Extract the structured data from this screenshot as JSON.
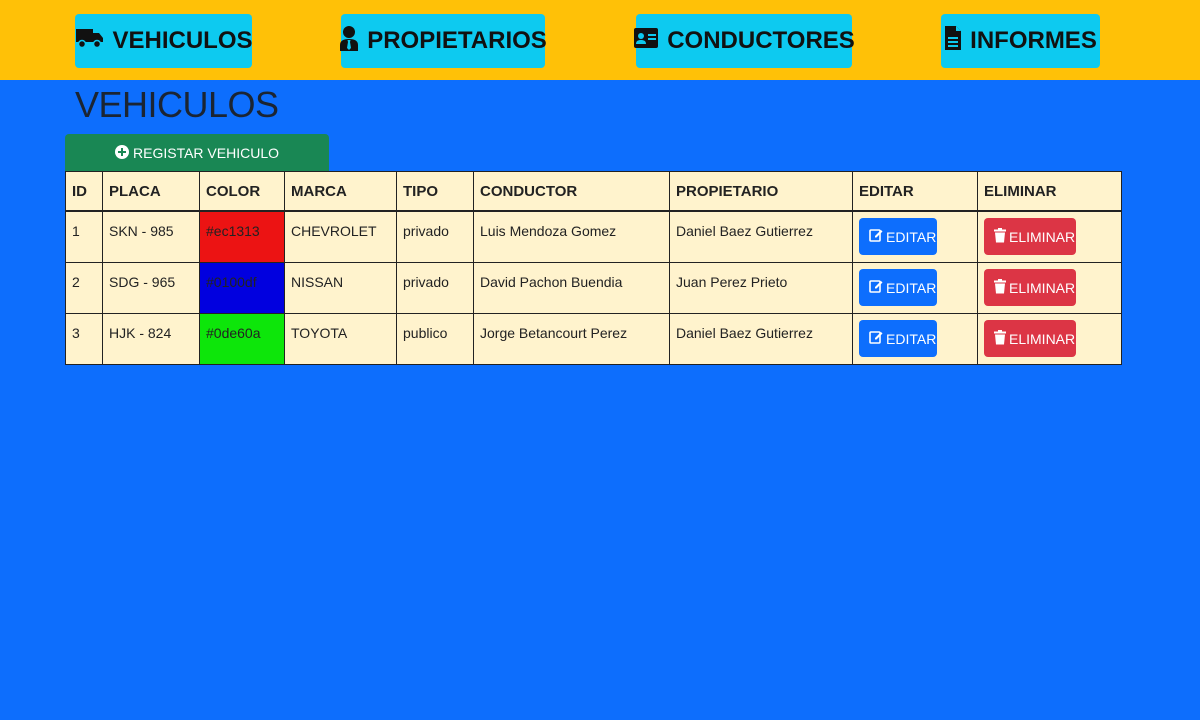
{
  "nav": {
    "vehiculos": "VEHICULOS",
    "propietarios": "PROPIETARIOS",
    "conductores": "CONDUCTORES",
    "informes": "INFORMES"
  },
  "page_title": "VEHICULOS",
  "register_label": "REGISTAR VEHICULO",
  "table": {
    "headers": [
      "ID",
      "PLACA",
      "COLOR",
      "MARCA",
      "TIPO",
      "CONDUCTOR",
      "PROPIETARIO",
      "EDITAR",
      "ELIMINAR"
    ],
    "rows": [
      {
        "id": "1",
        "placa": "SKN - 985",
        "color": "#ec1313",
        "marca": "CHEVROLET",
        "tipo": "privado",
        "conductor": "Luis Mendoza Gomez",
        "propietario": "Daniel Baez Gutierrez",
        "edit_label": "EDITAR",
        "delete_label": "ELIMINAR"
      },
      {
        "id": "2",
        "placa": "SDG - 965",
        "color": "#0100df",
        "marca": "NISSAN",
        "tipo": "privado",
        "conductor": "David Pachon Buendia",
        "propietario": "Juan Perez Prieto",
        "edit_label": "EDITAR",
        "delete_label": "ELIMINAR"
      },
      {
        "id": "3",
        "placa": "HJK - 824",
        "color": "#0de60a",
        "marca": "TOYOTA",
        "tipo": "publico",
        "conductor": "Jorge Betancourt Perez",
        "propietario": "Daniel Baez Gutierrez",
        "edit_label": "EDITAR",
        "delete_label": "ELIMINAR"
      }
    ]
  },
  "colors": {
    "background": "#0d6efd",
    "topbar": "#ffc107",
    "nav_button": "#0dcaf0",
    "register_button": "#198754",
    "table_bg": "#fff3cd",
    "edit_button": "#0d6efd",
    "delete_button": "#dc3545"
  },
  "icons": {
    "vehiculos": "truck-icon",
    "propietarios": "user-tie-icon",
    "conductores": "id-card-icon",
    "informes": "file-icon",
    "register": "plus-circle-icon",
    "edit": "edit-icon",
    "delete": "trash-icon"
  }
}
